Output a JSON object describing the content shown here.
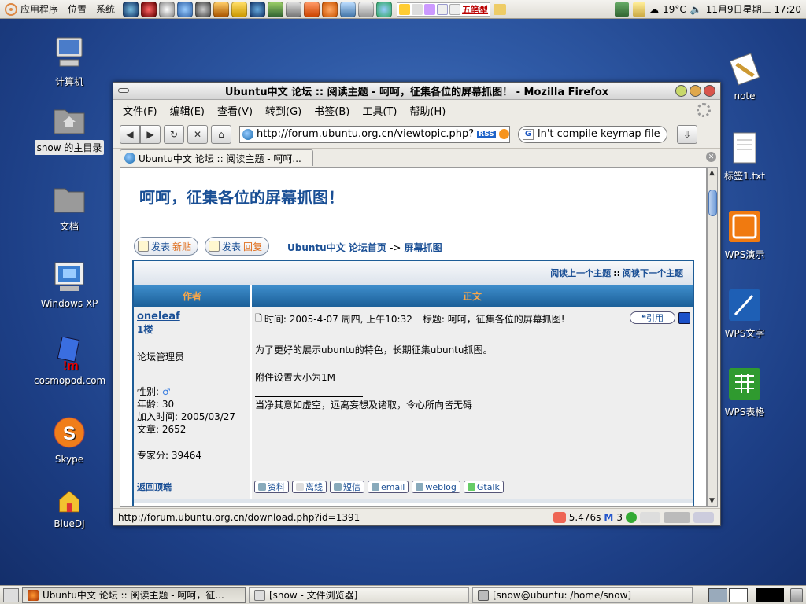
{
  "top_panel": {
    "menus": [
      "应用程序",
      "位置",
      "系统"
    ],
    "ime_label": "五笔型",
    "temperature": "19°C",
    "clock": "11月9日星期三 17:20"
  },
  "desktop_left": [
    {
      "label": "计算机",
      "icon": "computer-icon"
    },
    {
      "label": "snow 的主目录",
      "icon": "home-folder-icon"
    },
    {
      "label": "文档",
      "icon": "folder-icon"
    },
    {
      "label": "Windows XP",
      "icon": "windows-vm-icon"
    },
    {
      "label": "cosmopod.com",
      "icon": "cosmopod-icon"
    },
    {
      "label": "Skype",
      "icon": "skype-icon"
    },
    {
      "label": "BlueDJ",
      "icon": "bluedj-icon"
    }
  ],
  "desktop_right": [
    {
      "label": "note",
      "icon": "note-icon"
    },
    {
      "label": "标签1.txt",
      "icon": "text-file-icon"
    },
    {
      "label": "WPS演示",
      "icon": "wps-presentation-icon"
    },
    {
      "label": "WPS文字",
      "icon": "wps-writer-icon"
    },
    {
      "label": "WPS表格",
      "icon": "wps-spreadsheet-icon"
    }
  ],
  "window": {
    "title": "Ubuntu中文 论坛 :: 阅读主题 - 呵呵，征集各位的屏幕抓图！ - Mozilla Firefox",
    "menus": [
      "文件(F)",
      "编辑(E)",
      "查看(V)",
      "转到(G)",
      "书签(B)",
      "工具(T)",
      "帮助(H)"
    ],
    "url": "http://forum.ubuntu.org.cn/viewtopic.php?",
    "rss_label": "RSS",
    "search_value": "ln't compile keymap file",
    "tab_title": "Ubuntu中文 论坛 :: 阅读主题 - 呵呵...",
    "status_url": "http://forum.ubuntu.org.cn/download.php?id=1391",
    "status_time": "5.476s",
    "status_mail_count": "3"
  },
  "page": {
    "title": "呵呵，征集各位的屏幕抓图！",
    "new_topic_btn": {
      "main": "发表",
      "accent": "新贴"
    },
    "reply_btn": {
      "main": "发表",
      "accent": "回复"
    },
    "crumb_home": "Ubuntu中文 论坛首页",
    "crumb_sep": "->",
    "crumb_forum": "屏幕抓图",
    "prev_topic": "阅读上一个主题",
    "nav_sep": "::",
    "next_topic": "阅读下一个主题",
    "col_author": "作者",
    "col_body": "正文",
    "author": {
      "name": "oneleaf",
      "floor": "1楼",
      "rank": "论坛管理员",
      "gender_label": "性别:",
      "age": "年龄: 30",
      "joined": "加入时间: 2005/03/27",
      "posts": "文章: 2652",
      "expert": "专家分: 39464"
    },
    "post": {
      "time": "时间: 2005-4-07 周四, 上午10:32",
      "subject": "标题: 呵呵，征集各位的屏幕抓图!",
      "quote_label": "引用",
      "line1": "为了更好的展示ubuntu的特色，长期征集ubuntu抓图。",
      "line2": "附件设置大小为1M",
      "signature": "当净其意如虚空，远离妄想及诸取，令心所向皆无碍"
    },
    "back_to_top": "返回顶端",
    "profile_buttons": [
      "资料",
      "离线",
      "短信",
      "email",
      "weblog",
      "Gtalk"
    ]
  },
  "taskbar": [
    {
      "label": "Ubuntu中文 论坛 :: 阅读主题 - 呵呵，征...",
      "icon": "firefox-icon",
      "active": true
    },
    {
      "label": "[snow - 文件浏览器]",
      "icon": "file-browser-icon",
      "active": false
    },
    {
      "label": "[snow@ubuntu: /home/snow]",
      "icon": "terminal-icon",
      "active": false
    }
  ],
  "colors": {
    "accent": "#1a4f95",
    "header": "#1b5f98",
    "desktop": "#2f5aa6"
  }
}
